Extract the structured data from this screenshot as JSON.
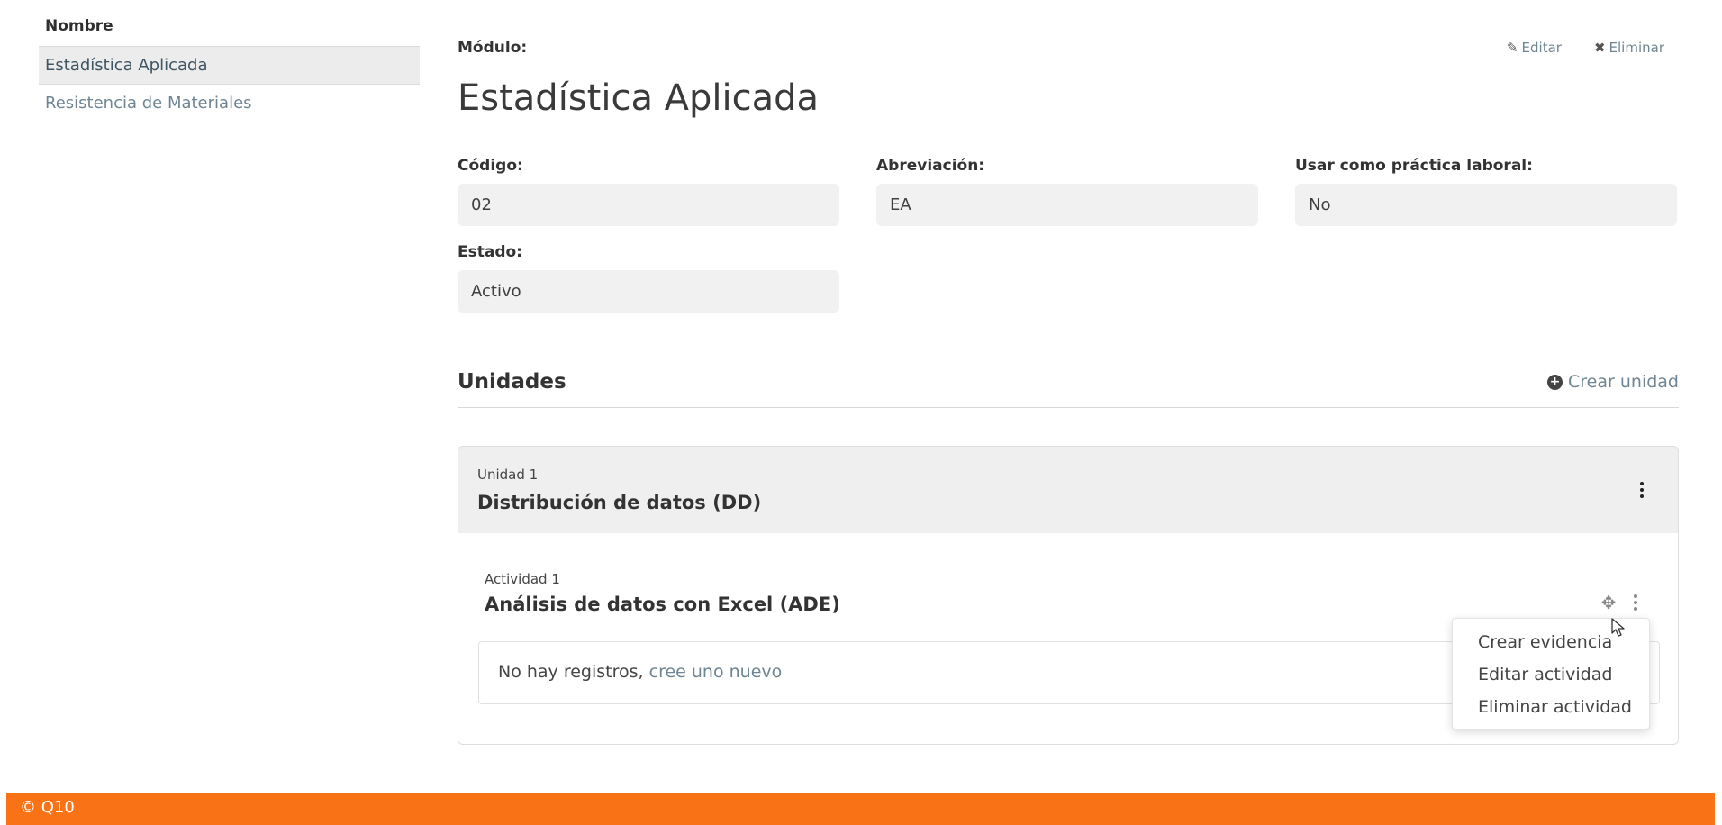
{
  "sidebar": {
    "header": "Nombre",
    "items": [
      {
        "label": "Estadística Aplicada"
      },
      {
        "label": "Resistencia de Materiales"
      }
    ]
  },
  "module": {
    "label": "Módulo:",
    "edit_label": "Editar",
    "delete_label": "Eliminar",
    "title": "Estadística Aplicada"
  },
  "fields": {
    "codigo": {
      "label": "Código:",
      "value": "02"
    },
    "abreviacion": {
      "label": "Abreviación:",
      "value": "EA"
    },
    "practica": {
      "label": "Usar como práctica laboral:",
      "value": "No"
    },
    "estado": {
      "label": "Estado:",
      "value": "Activo"
    }
  },
  "units": {
    "title": "Unidades",
    "create_label": "Crear unidad",
    "items": [
      {
        "number": "Unidad 1",
        "name": "Distribución de datos (DD)",
        "activity": {
          "number": "Actividad 1",
          "name": "Análisis de datos con Excel (ADE)",
          "empty_text": "No hay registros,",
          "empty_link": "cree uno nuevo"
        }
      }
    ]
  },
  "dropdown": {
    "items": [
      {
        "label": "Crear evidencia"
      },
      {
        "label": "Editar actividad"
      },
      {
        "label": "Eliminar actividad"
      }
    ]
  },
  "footer": {
    "text": "© Q10"
  },
  "colors": {
    "accent": "#f97316",
    "link": "#6f8593"
  },
  "icons": [
    "pencil-icon",
    "times-icon",
    "plus-circle-icon",
    "kebab-icon",
    "move-icon",
    "cursor-icon"
  ]
}
